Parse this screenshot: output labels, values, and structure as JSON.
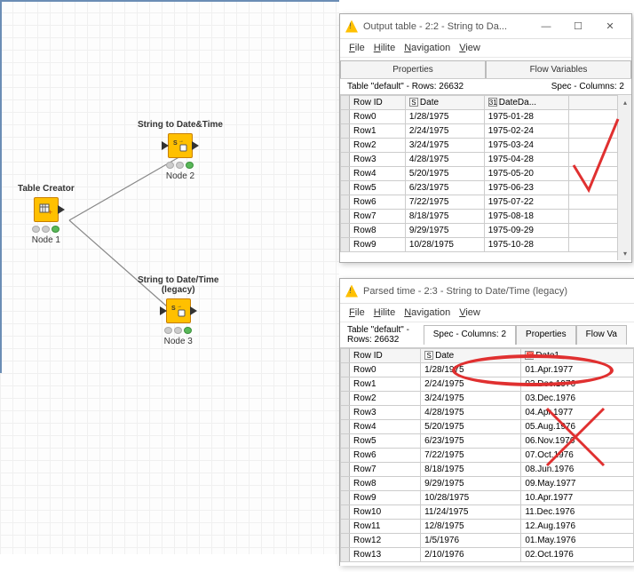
{
  "canvas": {
    "node1": {
      "title": "Table Creator",
      "sub": "Node 1"
    },
    "node2": {
      "title": "String to Date&Time",
      "sub": "Node 2"
    },
    "node3": {
      "title": "String to Date/Time",
      "title2": "(legacy)",
      "sub": "Node 3"
    }
  },
  "window1": {
    "title": "Output table - 2:2 - String to Da...",
    "menu": {
      "file": "File",
      "hilite": "Hilite",
      "nav": "Navigation",
      "view": "View"
    },
    "tab_props": "Properties",
    "tab_flow": "Flow Variables",
    "info_left": "Table \"default\" - Rows: 26632",
    "info_right": "Spec - Columns: 2",
    "col_rowid": "Row ID",
    "col_date": "Date",
    "col_dateda": "DateDa...",
    "rows": [
      {
        "id": "Row0",
        "d1": "1/28/1975",
        "d2": "1975-01-28"
      },
      {
        "id": "Row1",
        "d1": "2/24/1975",
        "d2": "1975-02-24"
      },
      {
        "id": "Row2",
        "d1": "3/24/1975",
        "d2": "1975-03-24"
      },
      {
        "id": "Row3",
        "d1": "4/28/1975",
        "d2": "1975-04-28"
      },
      {
        "id": "Row4",
        "d1": "5/20/1975",
        "d2": "1975-05-20"
      },
      {
        "id": "Row5",
        "d1": "6/23/1975",
        "d2": "1975-06-23"
      },
      {
        "id": "Row6",
        "d1": "7/22/1975",
        "d2": "1975-07-22"
      },
      {
        "id": "Row7",
        "d1": "8/18/1975",
        "d2": "1975-08-18"
      },
      {
        "id": "Row8",
        "d1": "9/29/1975",
        "d2": "1975-09-29"
      },
      {
        "id": "Row9",
        "d1": "10/28/1975",
        "d2": "1975-10-28"
      }
    ]
  },
  "window2": {
    "title": "Parsed time - 2:3 - String to Date/Time (legacy)",
    "menu": {
      "file": "File",
      "hilite": "Hilite",
      "nav": "Navigation",
      "view": "View"
    },
    "info_left": "Table \"default\" - Rows: 26632",
    "tab_spec": "Spec - Columns: 2",
    "tab_props": "Properties",
    "tab_flow": "Flow Va",
    "col_rowid": "Row ID",
    "col_date": "Date",
    "col_date1": "Date1",
    "rows": [
      {
        "id": "Row0",
        "d1": "1/28/1975",
        "d2": "01.Apr.1977"
      },
      {
        "id": "Row1",
        "d1": "2/24/1975",
        "d2": "02.Dec.1976"
      },
      {
        "id": "Row2",
        "d1": "3/24/1975",
        "d2": "03.Dec.1976"
      },
      {
        "id": "Row3",
        "d1": "4/28/1975",
        "d2": "04.Apr.1977"
      },
      {
        "id": "Row4",
        "d1": "5/20/1975",
        "d2": "05.Aug.1976"
      },
      {
        "id": "Row5",
        "d1": "6/23/1975",
        "d2": "06.Nov.1976"
      },
      {
        "id": "Row6",
        "d1": "7/22/1975",
        "d2": "07.Oct.1976"
      },
      {
        "id": "Row7",
        "d1": "8/18/1975",
        "d2": "08.Jun.1976"
      },
      {
        "id": "Row8",
        "d1": "9/29/1975",
        "d2": "09.May.1977"
      },
      {
        "id": "Row9",
        "d1": "10/28/1975",
        "d2": "10.Apr.1977"
      },
      {
        "id": "Row10",
        "d1": "11/24/1975",
        "d2": "11.Dec.1976"
      },
      {
        "id": "Row11",
        "d1": "12/8/1975",
        "d2": "12.Aug.1976"
      },
      {
        "id": "Row12",
        "d1": "1/5/1976",
        "d2": "01.May.1976"
      },
      {
        "id": "Row13",
        "d1": "2/10/1976",
        "d2": "02.Oct.1976"
      }
    ]
  }
}
